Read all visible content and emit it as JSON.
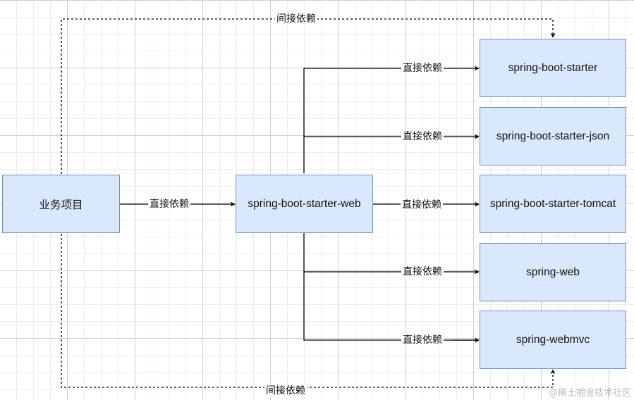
{
  "nodes": {
    "project": "业务项目",
    "starter_web": "spring-boot-starter-web",
    "starter": "spring-boot-starter",
    "starter_json": "spring-boot-starter-json",
    "starter_tomcat": "spring-boot-starter-tomcat",
    "web": "spring-web",
    "webmvc": "spring-webmvc"
  },
  "edges": {
    "direct_label": "直接依赖",
    "indirect_label": "间接依赖"
  },
  "watermark": "@稀土掘金技术社区",
  "colors": {
    "node_fill": "#dae8fc",
    "node_border": "#6c8ebf",
    "edge": "#000000"
  }
}
